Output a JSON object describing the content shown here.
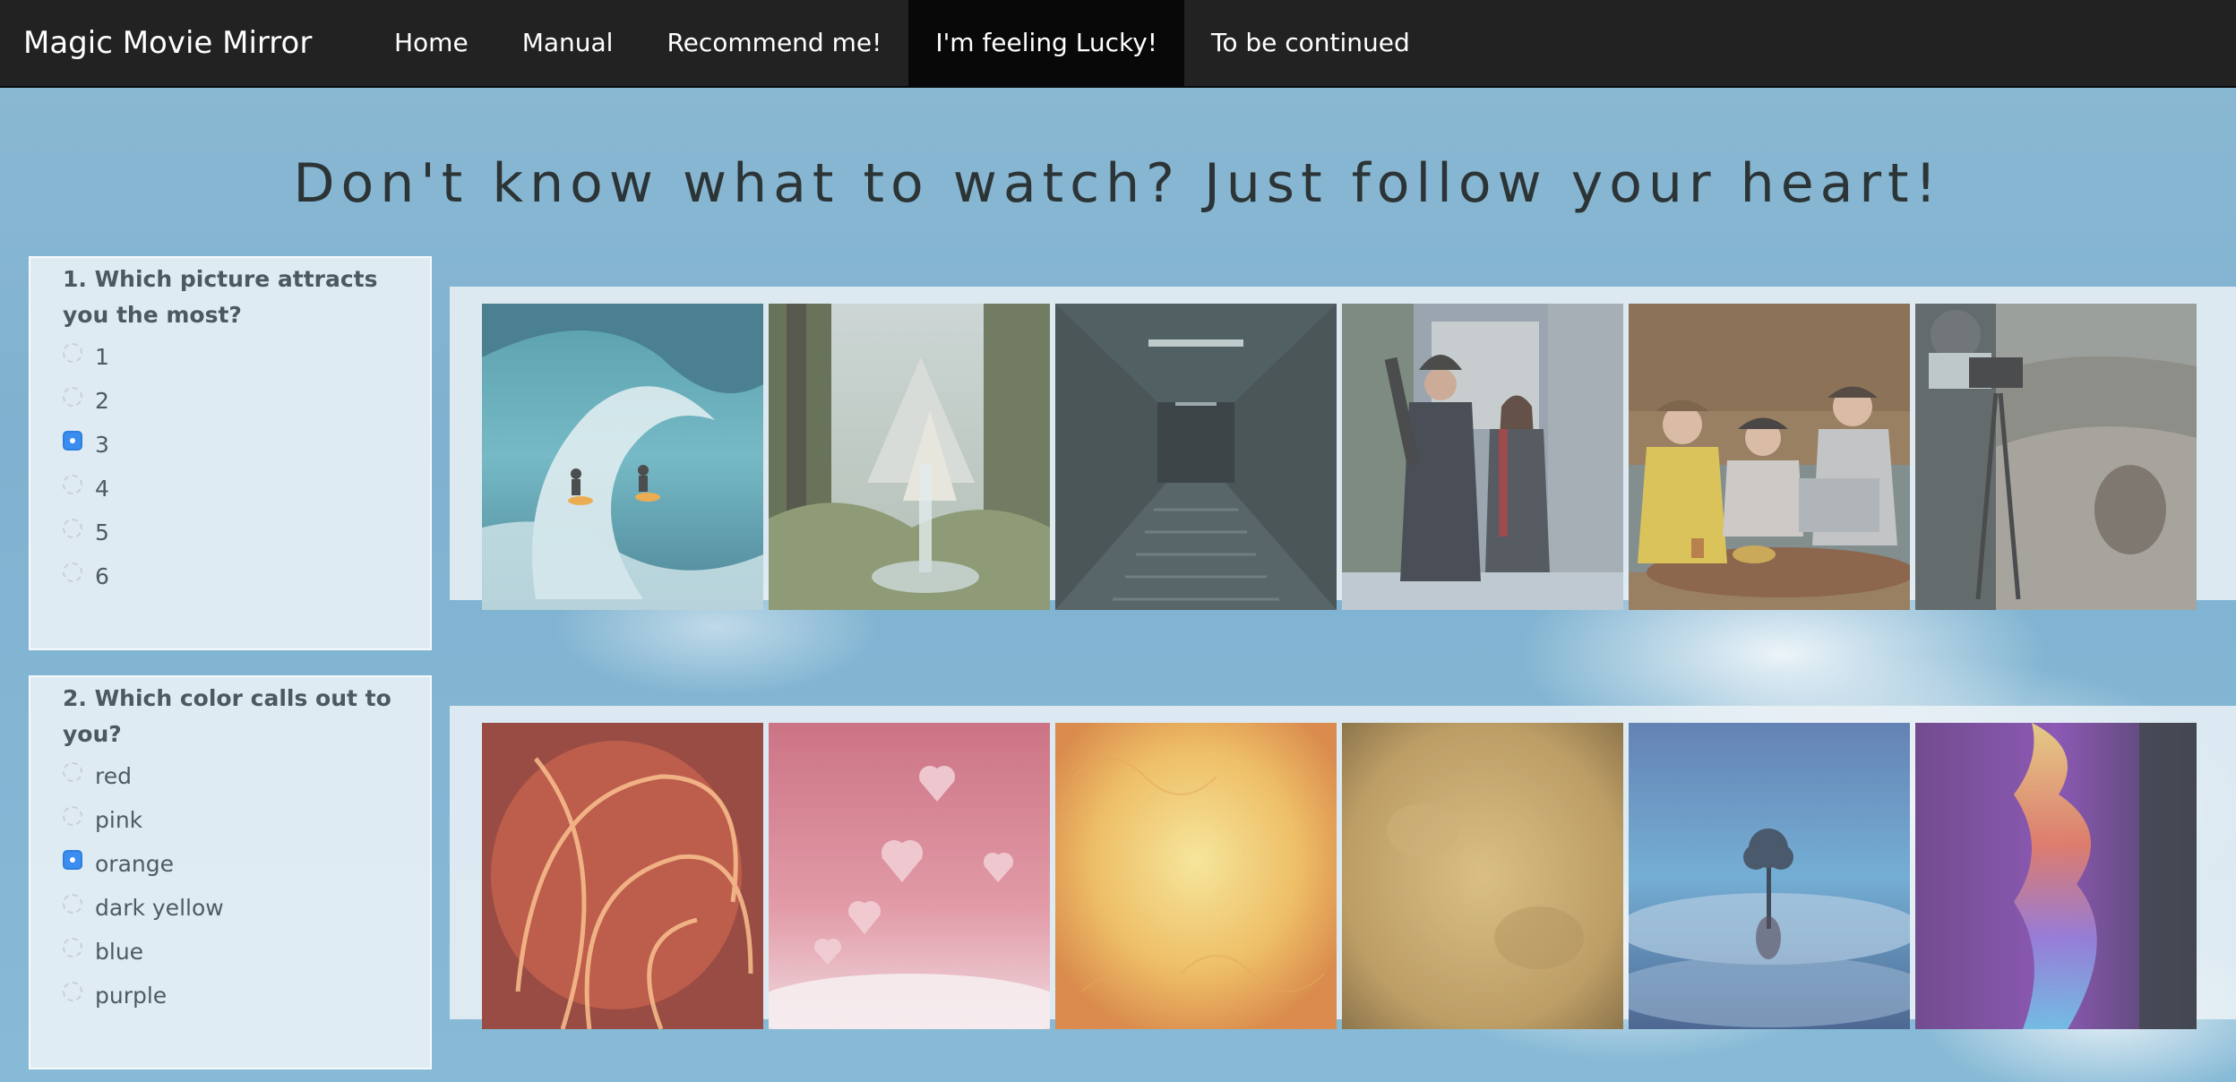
{
  "app": {
    "brand": "Magic Movie Mirror"
  },
  "nav": {
    "items": [
      {
        "label": "Home",
        "active": false
      },
      {
        "label": "Manual",
        "active": false
      },
      {
        "label": "Recommend me!",
        "active": false
      },
      {
        "label": "I'm feeling Lucky!",
        "active": true
      },
      {
        "label": "To be continued",
        "active": false
      }
    ]
  },
  "headline": "Don't know what to watch? Just follow your heart!",
  "questions": [
    {
      "title": "1. Which picture attracts you the most?",
      "options": [
        "1",
        "2",
        "3",
        "4",
        "5",
        "6"
      ],
      "selected": "3",
      "images": [
        "surfers-on-wave",
        "forest-waterfall-castle",
        "dark-corridor-stairs",
        "couple-with-guitar-street",
        "friends-on-couch-laptop",
        "cameraman-mountains"
      ]
    },
    {
      "title": "2. Which color calls out to you?",
      "options": [
        "red",
        "pink",
        "orange",
        "dark yellow",
        "blue",
        "purple"
      ],
      "selected": "orange",
      "images": [
        "red-light-swirls",
        "pink-hearts-bokeh",
        "orange-yellow-texture",
        "dark-yellow-parchment",
        "blue-lone-tree",
        "purple-color-smoke"
      ]
    }
  ],
  "colors": {
    "navbar": "#222222",
    "nav_active": "#080808",
    "radio_checked": "#3b8df0",
    "panel": "#ecf2f7"
  }
}
